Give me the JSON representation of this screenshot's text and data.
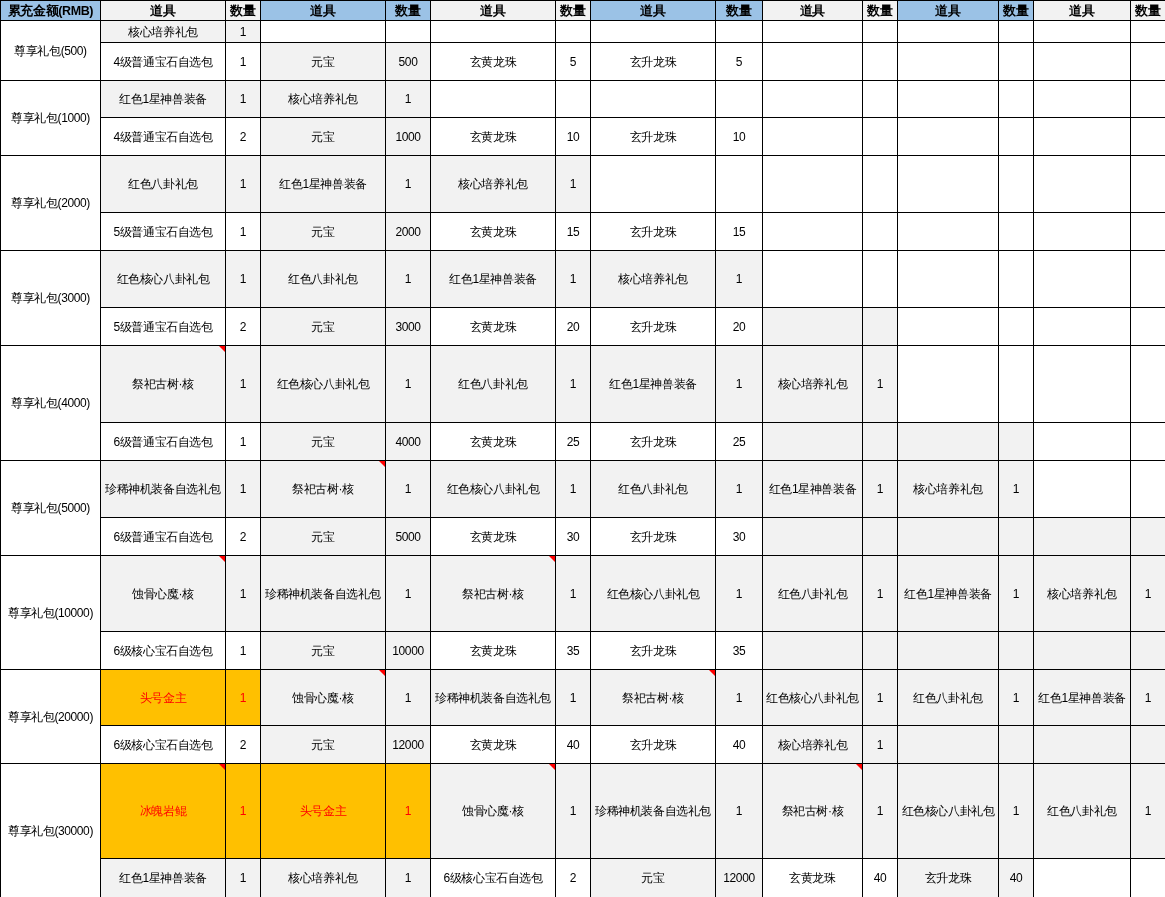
{
  "header": {
    "first": {
      "label": "累充金额(RMB)",
      "kind": "accent"
    },
    "columns": [
      {
        "label": "道具",
        "kind": "shaded"
      },
      {
        "label": "数量",
        "kind": "shaded"
      },
      {
        "label": "道具",
        "kind": "accent"
      },
      {
        "label": "数量",
        "kind": "accent"
      },
      {
        "label": "道具",
        "kind": "shaded"
      },
      {
        "label": "数量",
        "kind": "shaded"
      },
      {
        "label": "道具",
        "kind": "accent"
      },
      {
        "label": "数量",
        "kind": "accent"
      },
      {
        "label": "道具",
        "kind": "shaded"
      },
      {
        "label": "数量",
        "kind": "shaded"
      },
      {
        "label": "道具",
        "kind": "accent"
      },
      {
        "label": "数量",
        "kind": "accent"
      },
      {
        "label": "道具",
        "kind": "shaded"
      },
      {
        "label": "数量",
        "kind": "shaded"
      }
    ]
  },
  "tiers": [
    {
      "name": "尊享礼包(500)",
      "rows": [
        [
          {
            "text": "核心培养礼包",
            "kind": "shaded",
            "comment": false
          },
          {
            "text": "1",
            "kind": "shaded",
            "comment": false
          },
          {
            "kind": "plain",
            "comment": false
          },
          {
            "kind": "plain",
            "comment": false
          },
          {
            "kind": "plain",
            "comment": false
          },
          {
            "kind": "plain",
            "comment": false
          },
          {
            "kind": "plain",
            "comment": false
          },
          {
            "kind": "plain",
            "comment": false
          },
          {
            "kind": "plain",
            "comment": false
          },
          {
            "kind": "plain",
            "comment": false
          },
          {
            "kind": "plain",
            "comment": false
          },
          {
            "kind": "plain",
            "comment": false
          },
          {
            "kind": "plain",
            "comment": false
          },
          {
            "kind": "plain",
            "comment": false
          }
        ],
        [
          {
            "text": "4级普通宝石自选包",
            "kind": "plain",
            "comment": false
          },
          {
            "text": "1",
            "kind": "plain",
            "comment": false
          },
          {
            "text": "元宝",
            "kind": "shaded",
            "comment": false
          },
          {
            "text": "500",
            "kind": "shaded",
            "comment": false
          },
          {
            "text": "玄黄龙珠",
            "kind": "plain",
            "comment": false
          },
          {
            "text": "5",
            "kind": "plain",
            "comment": false
          },
          {
            "text": "玄升龙珠",
            "kind": "plain",
            "comment": false
          },
          {
            "text": "5",
            "kind": "plain",
            "comment": false
          },
          {
            "kind": "plain",
            "comment": false
          },
          {
            "kind": "plain",
            "comment": false
          },
          {
            "kind": "plain",
            "comment": false
          },
          {
            "kind": "plain",
            "comment": false
          },
          {
            "kind": "plain",
            "comment": false
          },
          {
            "kind": "plain",
            "comment": false
          }
        ]
      ]
    },
    {
      "name": "尊享礼包(1000)",
      "rows": [
        [
          {
            "text": "红色1星神兽装备",
            "kind": "shaded",
            "comment": false
          },
          {
            "text": "1",
            "kind": "shaded",
            "comment": false
          },
          {
            "text": "核心培养礼包",
            "kind": "shaded",
            "comment": false
          },
          {
            "text": "1",
            "kind": "shaded",
            "comment": false
          },
          {
            "kind": "plain",
            "comment": false
          },
          {
            "kind": "plain",
            "comment": false
          },
          {
            "kind": "plain",
            "comment": false
          },
          {
            "kind": "plain",
            "comment": false
          },
          {
            "kind": "plain",
            "comment": false
          },
          {
            "kind": "plain",
            "comment": false
          },
          {
            "kind": "plain",
            "comment": false
          },
          {
            "kind": "plain",
            "comment": false
          },
          {
            "kind": "plain",
            "comment": false
          },
          {
            "kind": "plain",
            "comment": false
          }
        ],
        [
          {
            "text": "4级普通宝石自选包",
            "kind": "plain",
            "comment": false
          },
          {
            "text": "2",
            "kind": "plain",
            "comment": false
          },
          {
            "text": "元宝",
            "kind": "shaded",
            "comment": false
          },
          {
            "text": "1000",
            "kind": "shaded",
            "comment": false
          },
          {
            "text": "玄黄龙珠",
            "kind": "plain",
            "comment": false
          },
          {
            "text": "10",
            "kind": "plain",
            "comment": false
          },
          {
            "text": "玄升龙珠",
            "kind": "plain",
            "comment": false
          },
          {
            "text": "10",
            "kind": "plain",
            "comment": false
          },
          {
            "kind": "plain",
            "comment": false
          },
          {
            "kind": "plain",
            "comment": false
          },
          {
            "kind": "plain",
            "comment": false
          },
          {
            "kind": "plain",
            "comment": false
          },
          {
            "kind": "plain",
            "comment": false
          },
          {
            "kind": "plain",
            "comment": false
          }
        ]
      ]
    },
    {
      "name": "尊享礼包(2000)",
      "rows": [
        [
          {
            "text": "红色八卦礼包",
            "kind": "shaded",
            "comment": false
          },
          {
            "text": "1",
            "kind": "shaded",
            "comment": false
          },
          {
            "text": "红色1星神兽装备",
            "kind": "shaded",
            "comment": false
          },
          {
            "text": "1",
            "kind": "shaded",
            "comment": false
          },
          {
            "text": "核心培养礼包",
            "kind": "shaded",
            "comment": false
          },
          {
            "text": "1",
            "kind": "shaded",
            "comment": false
          },
          {
            "kind": "plain",
            "comment": false
          },
          {
            "kind": "plain",
            "comment": false
          },
          {
            "kind": "plain",
            "comment": false
          },
          {
            "kind": "plain",
            "comment": false
          },
          {
            "kind": "plain",
            "comment": false
          },
          {
            "kind": "plain",
            "comment": false
          },
          {
            "kind": "plain",
            "comment": false
          },
          {
            "kind": "plain",
            "comment": false
          }
        ],
        [
          {
            "text": "5级普通宝石自选包",
            "kind": "plain",
            "comment": false
          },
          {
            "text": "1",
            "kind": "plain",
            "comment": false
          },
          {
            "text": "元宝",
            "kind": "shaded",
            "comment": false
          },
          {
            "text": "2000",
            "kind": "shaded",
            "comment": false
          },
          {
            "text": "玄黄龙珠",
            "kind": "plain",
            "comment": false
          },
          {
            "text": "15",
            "kind": "plain",
            "comment": false
          },
          {
            "text": "玄升龙珠",
            "kind": "plain",
            "comment": false
          },
          {
            "text": "15",
            "kind": "plain",
            "comment": false
          },
          {
            "kind": "plain",
            "comment": false
          },
          {
            "kind": "plain",
            "comment": false
          },
          {
            "kind": "plain",
            "comment": false
          },
          {
            "kind": "plain",
            "comment": false
          },
          {
            "kind": "plain",
            "comment": false
          },
          {
            "kind": "plain",
            "comment": false
          }
        ]
      ]
    },
    {
      "name": "尊享礼包(3000)",
      "rows": [
        [
          {
            "text": "红色核心八卦礼包",
            "kind": "shaded",
            "comment": false
          },
          {
            "text": "1",
            "kind": "shaded",
            "comment": false
          },
          {
            "text": "红色八卦礼包",
            "kind": "shaded",
            "comment": false
          },
          {
            "text": "1",
            "kind": "shaded",
            "comment": false
          },
          {
            "text": "红色1星神兽装备",
            "kind": "shaded",
            "comment": false
          },
          {
            "text": "1",
            "kind": "shaded",
            "comment": false
          },
          {
            "text": "核心培养礼包",
            "kind": "shaded",
            "comment": false
          },
          {
            "text": "1",
            "kind": "shaded",
            "comment": false
          },
          {
            "kind": "plain",
            "comment": false
          },
          {
            "kind": "plain",
            "comment": false
          },
          {
            "kind": "plain",
            "comment": false
          },
          {
            "kind": "plain",
            "comment": false
          },
          {
            "kind": "plain",
            "comment": false
          },
          {
            "kind": "plain",
            "comment": false
          }
        ],
        [
          {
            "text": "5级普通宝石自选包",
            "kind": "plain",
            "comment": false
          },
          {
            "text": "2",
            "kind": "plain",
            "comment": false
          },
          {
            "text": "元宝",
            "kind": "shaded",
            "comment": false
          },
          {
            "text": "3000",
            "kind": "shaded",
            "comment": false
          },
          {
            "text": "玄黄龙珠",
            "kind": "plain",
            "comment": false
          },
          {
            "text": "20",
            "kind": "plain",
            "comment": false
          },
          {
            "text": "玄升龙珠",
            "kind": "plain",
            "comment": false
          },
          {
            "text": "20",
            "kind": "plain",
            "comment": false
          },
          {
            "kind": "shaded",
            "comment": false
          },
          {
            "kind": "shaded",
            "comment": false
          },
          {
            "kind": "plain",
            "comment": false
          },
          {
            "kind": "plain",
            "comment": false
          },
          {
            "kind": "plain",
            "comment": false
          },
          {
            "kind": "plain",
            "comment": false
          }
        ]
      ]
    },
    {
      "name": "尊享礼包(4000)",
      "rows": [
        [
          {
            "text": "祭祀古树·核",
            "kind": "shaded",
            "comment": true
          },
          {
            "text": "1",
            "kind": "shaded",
            "comment": false
          },
          {
            "text": "红色核心八卦礼包",
            "kind": "shaded",
            "comment": false
          },
          {
            "text": "1",
            "kind": "shaded",
            "comment": false
          },
          {
            "text": "红色八卦礼包",
            "kind": "shaded",
            "comment": false
          },
          {
            "text": "1",
            "kind": "shaded",
            "comment": false
          },
          {
            "text": "红色1星神兽装备",
            "kind": "shaded",
            "comment": false
          },
          {
            "text": "1",
            "kind": "shaded",
            "comment": false
          },
          {
            "text": "核心培养礼包",
            "kind": "shaded",
            "comment": false
          },
          {
            "text": "1",
            "kind": "shaded",
            "comment": false
          },
          {
            "kind": "plain",
            "comment": false
          },
          {
            "kind": "plain",
            "comment": false
          },
          {
            "kind": "plain",
            "comment": false
          },
          {
            "kind": "plain",
            "comment": false
          }
        ],
        [
          {
            "text": "6级普通宝石自选包",
            "kind": "plain",
            "comment": false
          },
          {
            "text": "1",
            "kind": "plain",
            "comment": false
          },
          {
            "text": "元宝",
            "kind": "shaded",
            "comment": false
          },
          {
            "text": "4000",
            "kind": "shaded",
            "comment": false
          },
          {
            "text": "玄黄龙珠",
            "kind": "plain",
            "comment": false
          },
          {
            "text": "25",
            "kind": "plain",
            "comment": false
          },
          {
            "text": "玄升龙珠",
            "kind": "plain",
            "comment": false
          },
          {
            "text": "25",
            "kind": "plain",
            "comment": false
          },
          {
            "kind": "shaded",
            "comment": false
          },
          {
            "kind": "shaded",
            "comment": false
          },
          {
            "kind": "shaded",
            "comment": false
          },
          {
            "kind": "shaded",
            "comment": false
          },
          {
            "kind": "plain",
            "comment": false
          },
          {
            "kind": "plain",
            "comment": false
          }
        ]
      ]
    },
    {
      "name": "尊享礼包(5000)",
      "rows": [
        [
          {
            "text": "珍稀神机装备自选礼包",
            "kind": "shaded",
            "comment": false
          },
          {
            "text": "1",
            "kind": "shaded",
            "comment": false
          },
          {
            "text": "祭祀古树·核",
            "kind": "shaded",
            "comment": true
          },
          {
            "text": "1",
            "kind": "shaded",
            "comment": false
          },
          {
            "text": "红色核心八卦礼包",
            "kind": "shaded",
            "comment": false
          },
          {
            "text": "1",
            "kind": "shaded",
            "comment": false
          },
          {
            "text": "红色八卦礼包",
            "kind": "shaded",
            "comment": false
          },
          {
            "text": "1",
            "kind": "shaded",
            "comment": false
          },
          {
            "text": "红色1星神兽装备",
            "kind": "shaded",
            "comment": false
          },
          {
            "text": "1",
            "kind": "shaded",
            "comment": false
          },
          {
            "text": "核心培养礼包",
            "kind": "shaded",
            "comment": false
          },
          {
            "text": "1",
            "kind": "shaded",
            "comment": false
          },
          {
            "kind": "plain",
            "comment": false
          },
          {
            "kind": "plain",
            "comment": false
          }
        ],
        [
          {
            "text": "6级普通宝石自选包",
            "kind": "plain",
            "comment": false
          },
          {
            "text": "2",
            "kind": "plain",
            "comment": false
          },
          {
            "text": "元宝",
            "kind": "shaded",
            "comment": false
          },
          {
            "text": "5000",
            "kind": "shaded",
            "comment": false
          },
          {
            "text": "玄黄龙珠",
            "kind": "plain",
            "comment": false
          },
          {
            "text": "30",
            "kind": "plain",
            "comment": false
          },
          {
            "text": "玄升龙珠",
            "kind": "plain",
            "comment": false
          },
          {
            "text": "30",
            "kind": "plain",
            "comment": false
          },
          {
            "kind": "shaded",
            "comment": false
          },
          {
            "kind": "shaded",
            "comment": false
          },
          {
            "kind": "shaded",
            "comment": false
          },
          {
            "kind": "shaded",
            "comment": false
          },
          {
            "kind": "shaded",
            "comment": false
          },
          {
            "kind": "shaded",
            "comment": false
          }
        ]
      ]
    },
    {
      "name": "尊享礼包(10000)",
      "rows": [
        [
          {
            "text": "蚀骨心魔·核",
            "kind": "shaded",
            "comment": true
          },
          {
            "text": "1",
            "kind": "shaded",
            "comment": false
          },
          {
            "text": "珍稀神机装备自选礼包",
            "kind": "shaded",
            "comment": false
          },
          {
            "text": "1",
            "kind": "shaded",
            "comment": false
          },
          {
            "text": "祭祀古树·核",
            "kind": "shaded",
            "comment": true
          },
          {
            "text": "1",
            "kind": "shaded",
            "comment": false
          },
          {
            "text": "红色核心八卦礼包",
            "kind": "shaded",
            "comment": false
          },
          {
            "text": "1",
            "kind": "shaded",
            "comment": false
          },
          {
            "text": "红色八卦礼包",
            "kind": "shaded",
            "comment": false
          },
          {
            "text": "1",
            "kind": "shaded",
            "comment": false
          },
          {
            "text": "红色1星神兽装备",
            "kind": "shaded",
            "comment": false
          },
          {
            "text": "1",
            "kind": "shaded",
            "comment": false
          },
          {
            "text": "核心培养礼包",
            "kind": "shaded",
            "comment": false
          },
          {
            "text": "1",
            "kind": "shaded",
            "comment": false
          }
        ],
        [
          {
            "text": "6级核心宝石自选包",
            "kind": "plain",
            "comment": false
          },
          {
            "text": "1",
            "kind": "plain",
            "comment": false
          },
          {
            "text": "元宝",
            "kind": "shaded",
            "comment": false
          },
          {
            "text": "10000",
            "kind": "shaded",
            "comment": false
          },
          {
            "text": "玄黄龙珠",
            "kind": "plain",
            "comment": false
          },
          {
            "text": "35",
            "kind": "plain",
            "comment": false
          },
          {
            "text": "玄升龙珠",
            "kind": "plain",
            "comment": false
          },
          {
            "text": "35",
            "kind": "plain",
            "comment": false
          },
          {
            "kind": "shaded",
            "comment": false
          },
          {
            "kind": "shaded",
            "comment": false
          },
          {
            "kind": "shaded",
            "comment": false
          },
          {
            "kind": "shaded",
            "comment": false
          },
          {
            "kind": "shaded",
            "comment": false
          },
          {
            "kind": "shaded",
            "comment": false
          }
        ]
      ]
    },
    {
      "name": "尊享礼包(20000)",
      "rows": [
        [
          {
            "text": "头号金主",
            "kind": "highlight",
            "comment": false
          },
          {
            "text": "1",
            "kind": "highlight",
            "comment": false
          },
          {
            "text": "蚀骨心魔·核",
            "kind": "shaded",
            "comment": true
          },
          {
            "text": "1",
            "kind": "shaded",
            "comment": false
          },
          {
            "text": "珍稀神机装备自选礼包",
            "kind": "shaded",
            "comment": false
          },
          {
            "text": "1",
            "kind": "shaded",
            "comment": false
          },
          {
            "text": "祭祀古树·核",
            "kind": "shaded",
            "comment": true
          },
          {
            "text": "1",
            "kind": "shaded",
            "comment": false
          },
          {
            "text": "红色核心八卦礼包",
            "kind": "shaded",
            "comment": false
          },
          {
            "text": "1",
            "kind": "shaded",
            "comment": false
          },
          {
            "text": "红色八卦礼包",
            "kind": "shaded",
            "comment": false
          },
          {
            "text": "1",
            "kind": "shaded",
            "comment": false
          },
          {
            "text": "红色1星神兽装备",
            "kind": "shaded",
            "comment": false
          },
          {
            "text": "1",
            "kind": "shaded",
            "comment": false
          }
        ],
        [
          {
            "text": "6级核心宝石自选包",
            "kind": "plain",
            "comment": false
          },
          {
            "text": "2",
            "kind": "plain",
            "comment": false
          },
          {
            "text": "元宝",
            "kind": "shaded",
            "comment": false
          },
          {
            "text": "12000",
            "kind": "shaded",
            "comment": false
          },
          {
            "text": "玄黄龙珠",
            "kind": "plain",
            "comment": false
          },
          {
            "text": "40",
            "kind": "plain",
            "comment": false
          },
          {
            "text": "玄升龙珠",
            "kind": "plain",
            "comment": false
          },
          {
            "text": "40",
            "kind": "plain",
            "comment": false
          },
          {
            "text": "核心培养礼包",
            "kind": "shaded",
            "comment": false
          },
          {
            "text": "1",
            "kind": "shaded",
            "comment": false
          },
          {
            "kind": "shaded",
            "comment": false
          },
          {
            "kind": "shaded",
            "comment": false
          },
          {
            "kind": "shaded",
            "comment": false
          },
          {
            "kind": "shaded",
            "comment": false
          }
        ]
      ]
    },
    {
      "name": "尊享礼包(30000)",
      "rows": [
        [
          {
            "text": "冰魄岩鲲",
            "kind": "highlight",
            "comment": true
          },
          {
            "text": "1",
            "kind": "highlight",
            "comment": false
          },
          {
            "text": "头号金主",
            "kind": "highlight",
            "comment": false
          },
          {
            "text": "1",
            "kind": "highlight",
            "comment": false
          },
          {
            "text": "蚀骨心魔·核",
            "kind": "shaded",
            "comment": true
          },
          {
            "text": "1",
            "kind": "shaded",
            "comment": false
          },
          {
            "text": "珍稀神机装备自选礼包",
            "kind": "shaded",
            "comment": false
          },
          {
            "text": "1",
            "kind": "shaded",
            "comment": false
          },
          {
            "text": "祭祀古树·核",
            "kind": "shaded",
            "comment": true
          },
          {
            "text": "1",
            "kind": "shaded",
            "comment": false
          },
          {
            "text": "红色核心八卦礼包",
            "kind": "shaded",
            "comment": false
          },
          {
            "text": "1",
            "kind": "shaded",
            "comment": false
          },
          {
            "text": "红色八卦礼包",
            "kind": "shaded",
            "comment": false
          },
          {
            "text": "1",
            "kind": "shaded",
            "comment": false
          }
        ],
        [
          {
            "text": "红色1星神兽装备",
            "kind": "shaded",
            "comment": false
          },
          {
            "text": "1",
            "kind": "shaded",
            "comment": false
          },
          {
            "text": "核心培养礼包",
            "kind": "shaded",
            "comment": false
          },
          {
            "text": "1",
            "kind": "shaded",
            "comment": false
          },
          {
            "text": "6级核心宝石自选包",
            "kind": "plain",
            "comment": false
          },
          {
            "text": "2",
            "kind": "plain",
            "comment": false
          },
          {
            "text": "元宝",
            "kind": "shaded",
            "comment": false
          },
          {
            "text": "12000",
            "kind": "shaded",
            "comment": false
          },
          {
            "text": "玄黄龙珠",
            "kind": "plain",
            "comment": false
          },
          {
            "text": "40",
            "kind": "plain",
            "comment": false
          },
          {
            "text": "玄升龙珠",
            "kind": "shaded",
            "comment": false
          },
          {
            "text": "40",
            "kind": "shaded",
            "comment": false
          },
          {
            "kind": "plain",
            "comment": false
          },
          {
            "kind": "plain",
            "comment": false
          }
        ]
      ]
    }
  ]
}
